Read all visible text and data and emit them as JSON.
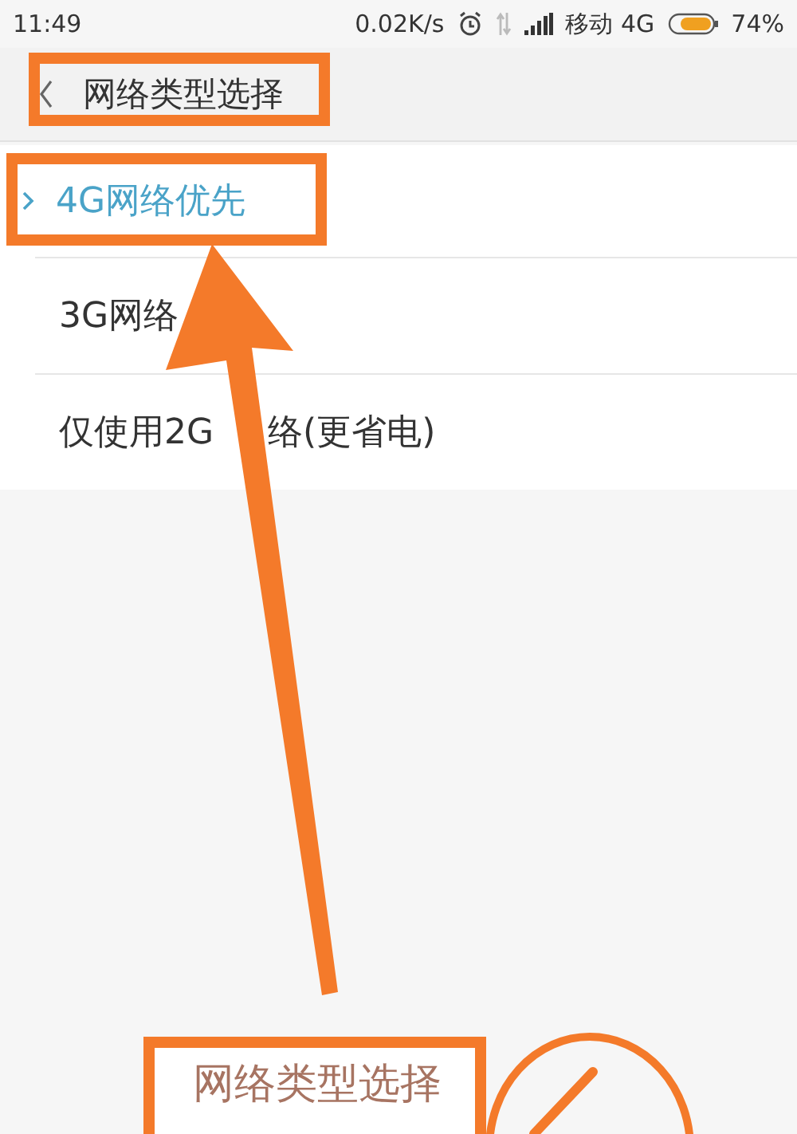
{
  "status_bar": {
    "time": "11:49",
    "speed": "0.02K/s",
    "carrier": "移动 4G",
    "battery": "74%"
  },
  "header": {
    "title": "网络类型选择",
    "highlighted": true
  },
  "options": [
    {
      "segments": [
        "4G网络优先"
      ],
      "selected": true,
      "highlighted": true
    },
    {
      "segments": [
        "3G网络"
      ],
      "selected": false,
      "highlighted": false
    },
    {
      "segments": [
        "仅使用2G",
        "络(更省电)"
      ],
      "selected": false,
      "highlighted": false
    }
  ],
  "caption": "网络类型选择"
}
